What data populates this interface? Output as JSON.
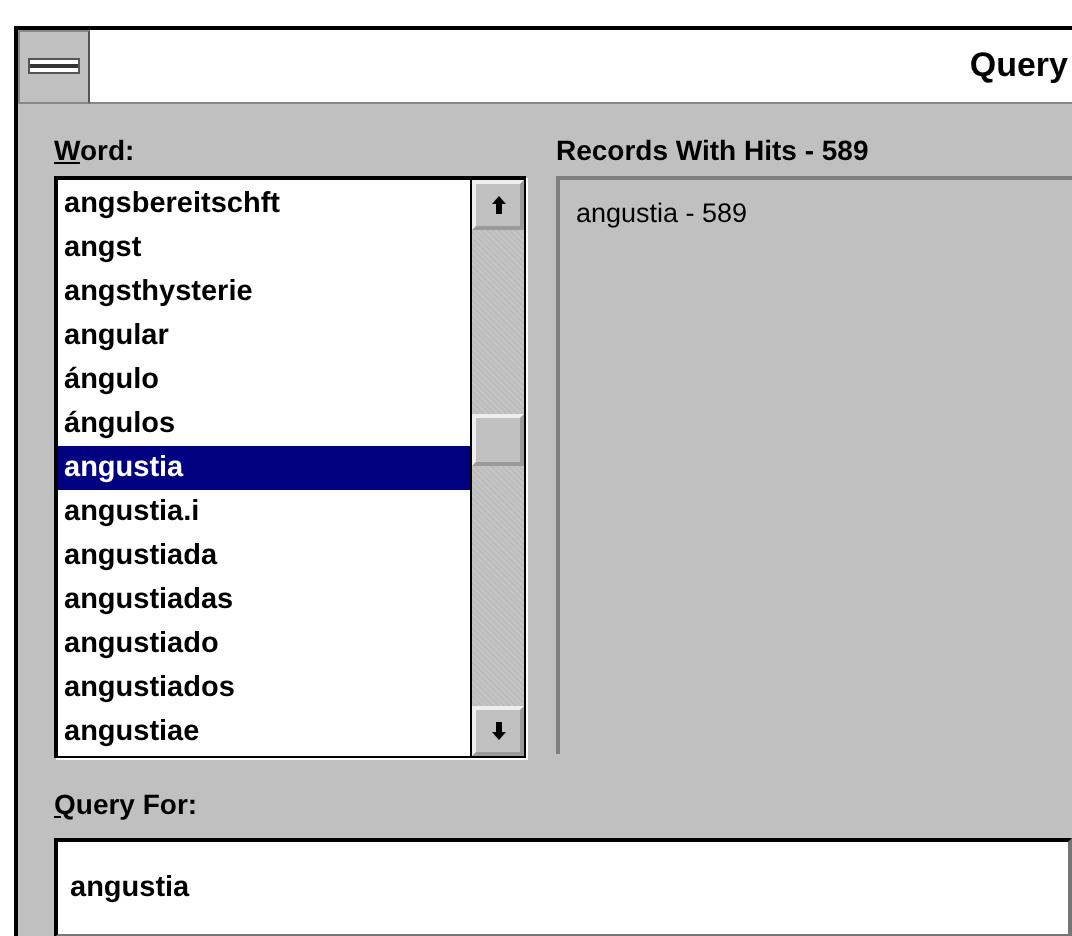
{
  "window": {
    "title": "Query"
  },
  "word_list": {
    "label": "Word:",
    "items": [
      {
        "text": "angsbereitschft",
        "selected": false
      },
      {
        "text": "angst",
        "selected": false
      },
      {
        "text": "angsthysterie",
        "selected": false
      },
      {
        "text": "angular",
        "selected": false
      },
      {
        "text": "ángulo",
        "selected": false
      },
      {
        "text": "ángulos",
        "selected": false
      },
      {
        "text": "angustia",
        "selected": true
      },
      {
        "text": "angustia.i",
        "selected": false
      },
      {
        "text": "angustiada",
        "selected": false
      },
      {
        "text": "angustiadas",
        "selected": false
      },
      {
        "text": "angustiado",
        "selected": false
      },
      {
        "text": "angustiados",
        "selected": false
      },
      {
        "text": "angustiae",
        "selected": false
      }
    ]
  },
  "hits_list": {
    "label": "Records With Hits - 589",
    "items": [
      "angustia - 589"
    ]
  },
  "query_field": {
    "label": "Query For:",
    "value": "angustia"
  }
}
